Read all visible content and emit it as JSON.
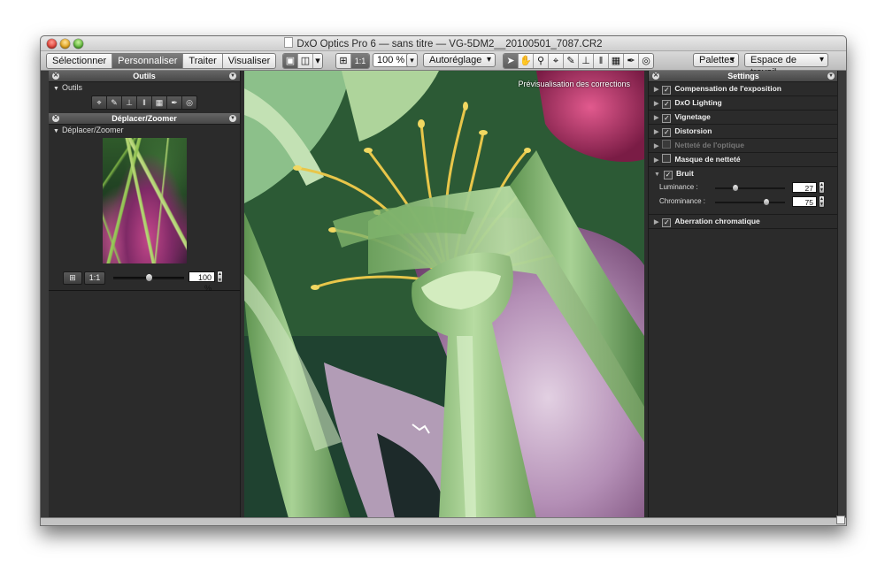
{
  "window": {
    "title": "DxO Optics Pro 6 — sans titre — VG-5DM2__20100501_7087.CR2"
  },
  "toolbar": {
    "modes": [
      {
        "label": "Sélectionner",
        "active": false
      },
      {
        "label": "Personnaliser",
        "active": true
      },
      {
        "label": "Traiter",
        "active": false
      },
      {
        "label": "Visualiser",
        "active": false
      }
    ],
    "one_to_one": "1:1",
    "zoom_value": "100 %",
    "auto_preset": "Autoréglage",
    "palettes": "Palettes",
    "workspace": "Espace de travail"
  },
  "left_panel": {
    "tools_panel": {
      "title": "Outils",
      "section": "Outils"
    },
    "nav_panel": {
      "title": "Déplacer/Zoomer",
      "section": "Déplacer/Zoomer",
      "one_to_one": "1:1",
      "zoom_value": "100 %",
      "zoom_level": 0.5
    }
  },
  "image": {
    "preview_label": "Prévisualisation des corrections"
  },
  "right_panel": {
    "title": "Settings",
    "items": [
      {
        "label": "Compensation de l'exposition",
        "checked": true,
        "enabled": true
      },
      {
        "label": "DxO Lighting",
        "checked": true,
        "enabled": true
      },
      {
        "label": "Vignetage",
        "checked": true,
        "enabled": true
      },
      {
        "label": "Distorsion",
        "checked": true,
        "enabled": true
      },
      {
        "label": "Netteté de l'optique",
        "checked": false,
        "enabled": false
      },
      {
        "label": "Masque de netteté",
        "checked": false,
        "enabled": true
      },
      {
        "label": "Bruit",
        "checked": true,
        "enabled": true
      },
      {
        "label": "Aberration chromatique",
        "checked": true,
        "enabled": true
      }
    ],
    "noise": {
      "luminance_label": "Luminance :",
      "luminance_value": "27",
      "luminance_fraction": 0.27,
      "chrominance_label": "Chrominance :",
      "chrominance_value": "75",
      "chrominance_fraction": 0.75
    }
  },
  "colors": {
    "panel_bg": "#2b2b2b",
    "active_tab": "#6b6b6b",
    "stem_green": "#8fc27f",
    "stamen_yellow": "#e8c64a",
    "petal_purple": "#b48fb6"
  }
}
